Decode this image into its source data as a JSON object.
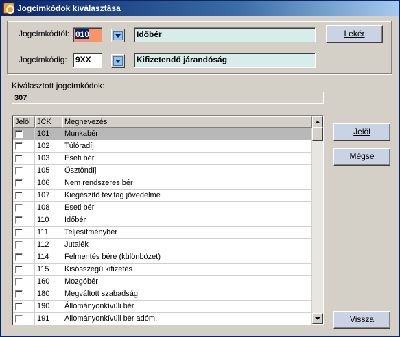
{
  "window": {
    "title": "Jogcímkódok kiválasztása",
    "close_glyph": "×"
  },
  "filter": {
    "from_label": "Jogcímkódtól:",
    "from_value": "010",
    "from_desc": "Időbér",
    "to_label": "Jogcímkódig:",
    "to_value": "9XX",
    "to_desc": "Kifizetendő járandóság",
    "fetch_button": "Lekér"
  },
  "selected": {
    "label": "Kiválasztott jogcímkódok:",
    "value": "307"
  },
  "grid": {
    "columns": [
      "Jelöl",
      "JCK",
      "Megnevezés"
    ],
    "rows": [
      {
        "code": "101",
        "name": "Munkabér"
      },
      {
        "code": "102",
        "name": "Túlóradíj"
      },
      {
        "code": "103",
        "name": "Eseti bér"
      },
      {
        "code": "105",
        "name": "Ösztöndíj"
      },
      {
        "code": "106",
        "name": "Nem rendszeres bér"
      },
      {
        "code": "107",
        "name": "Kiegészítő tev.tag jövedelme"
      },
      {
        "code": "108",
        "name": "Eseti bér"
      },
      {
        "code": "110",
        "name": "Időbér"
      },
      {
        "code": "111",
        "name": "Teljesítménybér"
      },
      {
        "code": "112",
        "name": "Jutalék"
      },
      {
        "code": "114",
        "name": "Felmentés bére (különbözet)"
      },
      {
        "code": "115",
        "name": "Kisösszegű kifizetés"
      },
      {
        "code": "160",
        "name": "Mozgóbér"
      },
      {
        "code": "180",
        "name": "Megváltott szabadság"
      },
      {
        "code": "190",
        "name": "Állományonkívüli bér"
      },
      {
        "code": "191",
        "name": "Állományonkívüli bér adóm."
      }
    ]
  },
  "buttons": {
    "mark": "Jelöl",
    "cancel": "Mégse",
    "back": "Vissza"
  },
  "colors": {
    "title_start": "#0a246a",
    "title_end": "#a6caf0",
    "active_input": "#f4956a",
    "desc_field": "#d6ede9"
  },
  "icons": [
    "app-icon",
    "dropdown-arrow-icon",
    "scroll-up-icon",
    "scroll-down-icon",
    "checkbox-icon"
  ]
}
